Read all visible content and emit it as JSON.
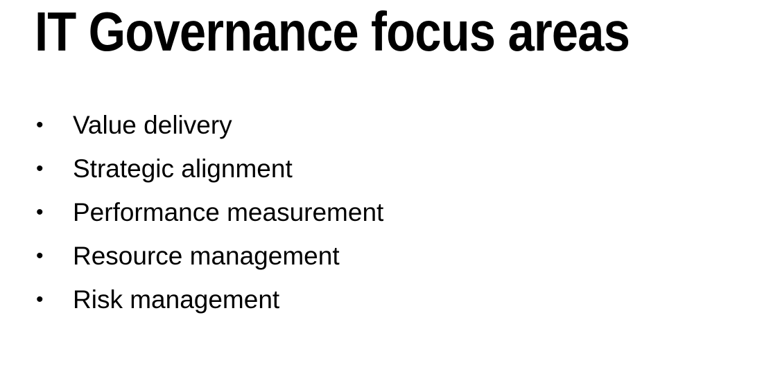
{
  "slide": {
    "title": "IT Governance focus areas",
    "bullet_symbol": "•",
    "items": [
      {
        "label": "Value delivery"
      },
      {
        "label": "Strategic alignment"
      },
      {
        "label": "Performance measurement"
      },
      {
        "label": "Resource management"
      },
      {
        "label": "Risk management"
      }
    ]
  }
}
